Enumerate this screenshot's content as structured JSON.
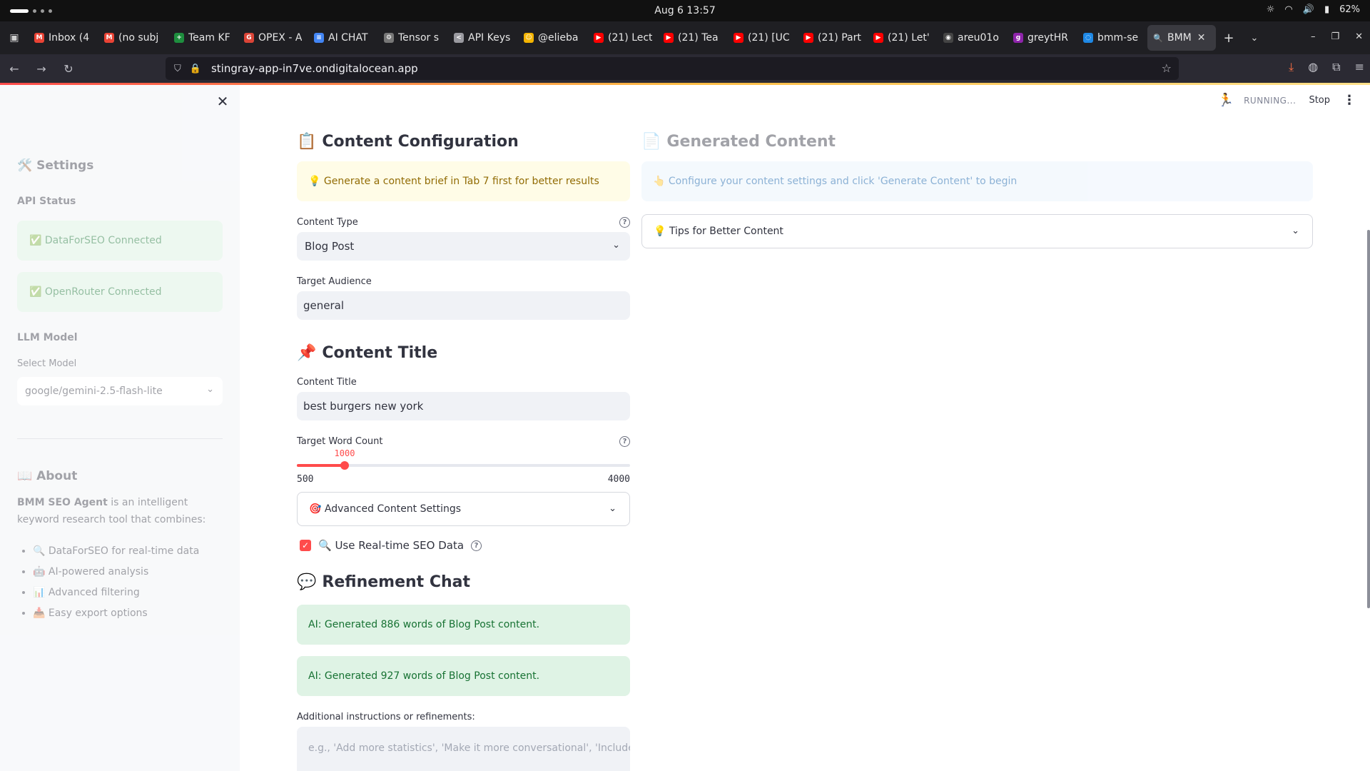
{
  "os": {
    "clock": "Aug 6  13:57",
    "battery": "62%"
  },
  "browser": {
    "tabs": [
      {
        "label": "Inbox (4",
        "color": "#ea4335",
        "glyph": "M"
      },
      {
        "label": "(no subj",
        "color": "#ea4335",
        "glyph": "M"
      },
      {
        "label": "Team KF",
        "color": "#1e8e3e",
        "glyph": "+"
      },
      {
        "label": "OPEX - A",
        "color": "#db4437",
        "glyph": "G"
      },
      {
        "label": "AI CHAT",
        "color": "#4285f4",
        "glyph": "≡"
      },
      {
        "label": "Tensor s",
        "color": "#777777",
        "glyph": "⚙"
      },
      {
        "label": "API Keys",
        "color": "#9a9aa0",
        "glyph": "<"
      },
      {
        "label": "@elieba",
        "color": "#f4b400",
        "glyph": "☺"
      },
      {
        "label": "(21) Lect",
        "color": "#ff0000",
        "glyph": "▶"
      },
      {
        "label": "(21) Tea",
        "color": "#ff0000",
        "glyph": "▶"
      },
      {
        "label": "(21) [UC",
        "color": "#ff0000",
        "glyph": "▶"
      },
      {
        "label": "(21) Part",
        "color": "#ff0000",
        "glyph": "▶"
      },
      {
        "label": "(21) Let'",
        "color": "#ff0000",
        "glyph": "▶"
      },
      {
        "label": "areu01o",
        "color": "#444444",
        "glyph": "◉"
      },
      {
        "label": "greytHR",
        "color": "#8e24aa",
        "glyph": "g"
      },
      {
        "label": "bmm-se",
        "color": "#1e88e5",
        "glyph": "◌"
      }
    ],
    "active_tab": {
      "label": "BMM",
      "glyph": "🔍"
    },
    "url": "stingray-app-in7ve.ondigitalocean.app"
  },
  "header": {
    "status": "RUNNING...",
    "stop_label": "Stop"
  },
  "sidebar": {
    "title": "🛠️ Settings",
    "api_status_title": "API Status",
    "dataforseo_status": "✅ DataForSEO Connected",
    "openrouter_status": "✅ OpenRouter Connected",
    "llm_title": "LLM Model",
    "select_model_label": "Select Model",
    "selected_model": "google/gemini-2.5-flash-lite",
    "about_title": "📖 About",
    "about_bold": "BMM SEO Agent",
    "about_text": " is an intelligent keyword research tool that combines:",
    "about_items": [
      "🔍 DataForSEO for real-time data",
      "🤖 AI-powered analysis",
      "📊 Advanced filtering",
      "📥 Easy export options"
    ]
  },
  "config": {
    "title_emoji": "📋",
    "title": "Content Configuration",
    "brief_tip": "💡 Generate a content brief in Tab 7 first for better results",
    "content_type_label": "Content Type",
    "content_type_value": "Blog Post",
    "target_audience_label": "Target Audience",
    "target_audience_value": "general"
  },
  "title_section": {
    "title_emoji": "📌",
    "title": "Content Title",
    "field_label": "Content Title",
    "field_value": "best burgers new york",
    "word_count_label": "Target Word Count",
    "word_count": {
      "value": 1000,
      "min": 500,
      "max": 4000
    },
    "word_count_value_text": "1000",
    "word_count_min_text": "500",
    "word_count_max_text": "4000",
    "advanced_label": "🎯 Advanced Content Settings",
    "realtime_label": "🔍 Use Real-time SEO Data",
    "realtime_checked": true
  },
  "chat": {
    "title_emoji": "💬",
    "title": "Refinement Chat",
    "messages": [
      "AI: Generated 886 words of Blog Post content.",
      "AI: Generated 927 words of Blog Post content."
    ],
    "instructions_label": "Additional instructions or refinements:",
    "instructions_placeholder": "e.g., 'Add more statistics', 'Make it more conversational', 'Include"
  },
  "generated": {
    "title_emoji": "📄",
    "title": "Generated Content",
    "info": "👆 Configure your content settings and click 'Generate Content' to begin",
    "tips_label": "💡 Tips for Better Content"
  }
}
